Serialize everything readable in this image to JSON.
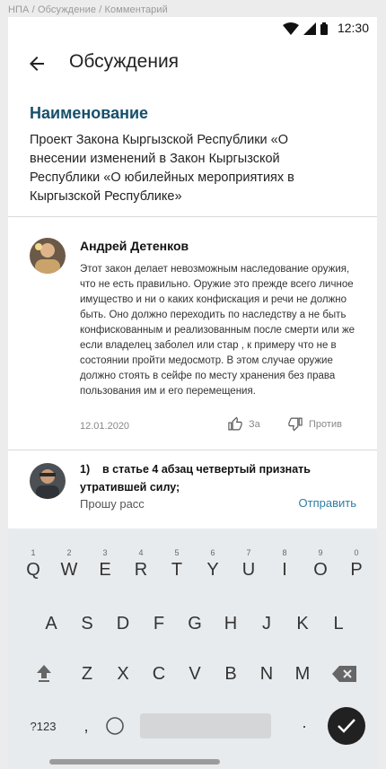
{
  "breadcrumb": "НПА / Обсуждение / Комментарий",
  "status_bar": {
    "time": "12:30"
  },
  "app_bar": {
    "title": "Обсуждения"
  },
  "section": {
    "title": "Наименование",
    "body": "Проект Закона Кыргызской Республики «О внесении изменений в Закон Кыргызской Республики «О юбилейных мероприятиях в Кыргызской Республике»"
  },
  "comment": {
    "author": "Андрей Детенков",
    "text": "Этот закон делает невозможным наследование оружия, что не есть правильно. Оружие это прежде всего личное имущество и ни о каких конфискация и речи не должно быть. Оно должно переходить по наследству а не быть конфискованным и реализованным после смерти или же если владелец заболел или стар , к примеру что не в состоянии пройти медосмотр. В этом случае оружие должно стоять в сейфе по месту хранения без права пользования им и его перемещения.",
    "date": "12.01.2020",
    "vote_for": "За",
    "vote_against": "Против"
  },
  "reply": {
    "quote": "1)    в статье 4 абзац четвертый признать утратившей силу;",
    "input_value": "Прошу расс",
    "send_label": "Отправить"
  },
  "keyboard": {
    "row1": [
      {
        "k": "Q",
        "n": "1"
      },
      {
        "k": "W",
        "n": "2"
      },
      {
        "k": "E",
        "n": "3"
      },
      {
        "k": "R",
        "n": "4"
      },
      {
        "k": "T",
        "n": "5"
      },
      {
        "k": "Y",
        "n": "6"
      },
      {
        "k": "U",
        "n": "7"
      },
      {
        "k": "I",
        "n": "8"
      },
      {
        "k": "O",
        "n": "9"
      },
      {
        "k": "P",
        "n": "0"
      }
    ],
    "row2": [
      "A",
      "S",
      "D",
      "F",
      "G",
      "H",
      "J",
      "K",
      "L"
    ],
    "row3": [
      "Z",
      "X",
      "C",
      "V",
      "B",
      "N",
      "M"
    ],
    "symbols_label": "?123",
    "comma": ",",
    "period": "."
  }
}
